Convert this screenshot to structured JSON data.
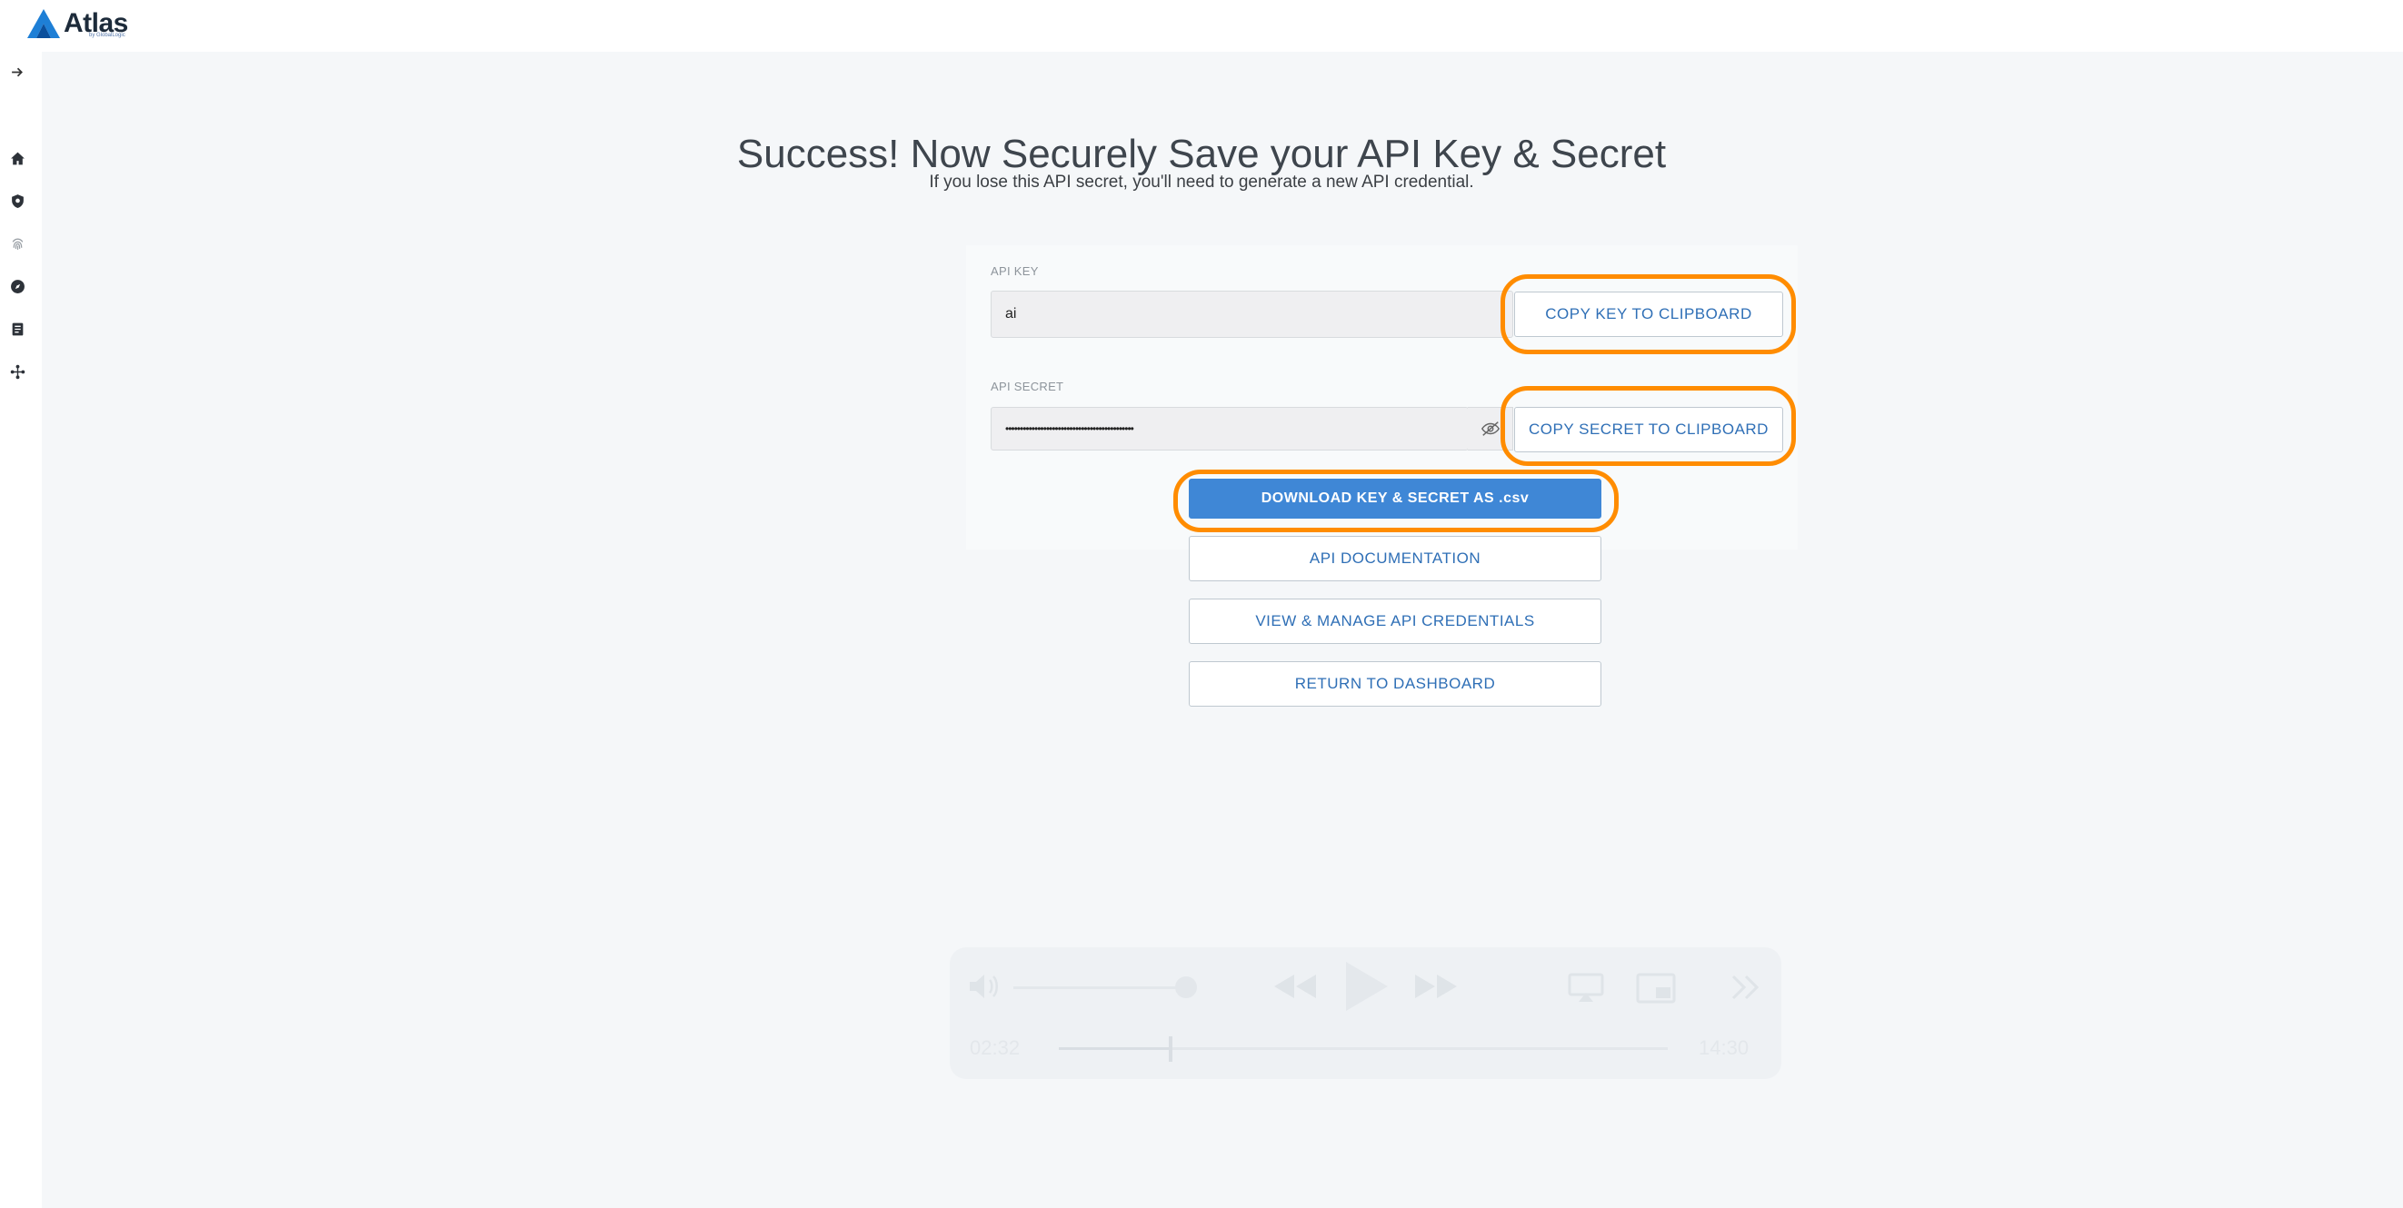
{
  "app": {
    "logo_text": "Atlas",
    "logo_subtext": "by GlobalLogic"
  },
  "sidebar": {
    "items": [
      {
        "icon": "expand-arrow-icon"
      },
      {
        "icon": "home-icon"
      },
      {
        "icon": "shield-icon"
      },
      {
        "icon": "fingerprint-icon"
      },
      {
        "icon": "compass-icon"
      },
      {
        "icon": "document-icon"
      },
      {
        "icon": "network-icon"
      }
    ]
  },
  "page": {
    "title": "Success! Now Securely Save your API Key & Secret",
    "subtitle": "If you lose this API secret, you'll need to generate a new API credential."
  },
  "api_key": {
    "label": "API KEY",
    "value": "ai",
    "copy_label": "COPY KEY TO CLIPBOARD"
  },
  "api_secret": {
    "label": "API SECRET",
    "value": "••••••••••••••••••••••••••••••••••••••••••••",
    "copy_label": "COPY SECRET TO CLIPBOARD"
  },
  "actions": {
    "download_label": "DOWNLOAD KEY & SECRET AS .csv",
    "docs_label": "API DOCUMENTATION",
    "manage_label": "VIEW & MANAGE API CREDENTIALS",
    "dashboard_label": "RETURN TO DASHBOARD"
  },
  "video_controls": {
    "elapsed": "02:32",
    "total": "14:30",
    "progress": 0.18
  },
  "colors": {
    "primary": "#3f87d6",
    "highlight": "#ff8c00",
    "link_text": "#2f6fb6",
    "background": "#f5f7f9"
  }
}
